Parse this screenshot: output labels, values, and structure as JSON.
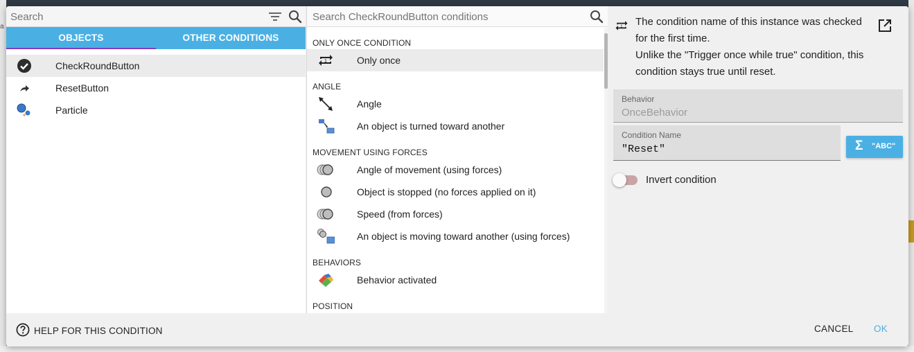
{
  "left_panel": {
    "search": {
      "placeholder": "Search",
      "value": ""
    },
    "tabs": [
      {
        "label": "OBJECTS",
        "active": true
      },
      {
        "label": "OTHER CONDITIONS",
        "active": false
      }
    ],
    "objects": [
      {
        "label": "CheckRoundButton",
        "icon": "checkmark-circle-icon",
        "selected": true
      },
      {
        "label": "ResetButton",
        "icon": "arrow-icon",
        "selected": false
      },
      {
        "label": "Particle",
        "icon": "particle-icon",
        "selected": false
      }
    ]
  },
  "middle_panel": {
    "search": {
      "placeholder": "Search CheckRoundButton conditions",
      "value": ""
    },
    "groups": [
      {
        "title": "ONLY ONCE CONDITION",
        "items": [
          {
            "label": "Only once",
            "icon": "repeat-once-icon",
            "selected": true
          }
        ]
      },
      {
        "title": "ANGLE",
        "items": [
          {
            "label": "Angle",
            "icon": "angle-arrow-icon"
          },
          {
            "label": "An object is turned toward another",
            "icon": "turn-toward-icon"
          }
        ]
      },
      {
        "title": "MOVEMENT USING FORCES",
        "items": [
          {
            "label": "Angle of movement (using forces)",
            "icon": "force-circles-icon"
          },
          {
            "label": "Object is stopped (no forces applied on it)",
            "icon": "stopped-circle-icon"
          },
          {
            "label": "Speed (from forces)",
            "icon": "force-circles-icon"
          },
          {
            "label": "An object is moving toward another (using forces)",
            "icon": "move-toward-icon"
          }
        ]
      },
      {
        "title": "BEHAVIORS",
        "items": [
          {
            "label": "Behavior activated",
            "icon": "behavior-icon"
          }
        ]
      },
      {
        "title": "POSITION",
        "items": []
      }
    ]
  },
  "right_panel": {
    "description": [
      "The condition name of this instance was checked for the first time.",
      "Unlike the \"Trigger once while true\" condition, this condition stays true until reset."
    ],
    "behavior_field": {
      "label": "Behavior",
      "value": "OnceBehavior"
    },
    "condition_name_field": {
      "label": "Condition Name",
      "value": "\"Reset\""
    },
    "expression_button": {
      "symbol": "Σ",
      "label": "\"ABC\""
    },
    "invert_condition": {
      "label": "Invert condition",
      "checked": false
    }
  },
  "footer": {
    "help_label": "HELP FOR THIS CONDITION",
    "cancel_label": "CANCEL",
    "ok_label": "OK"
  },
  "colors": {
    "accent": "#4ab0e4",
    "tab_indicator": "#7e3fbf",
    "selected_row": "#ebebeb",
    "panel_bg": "#f0f0f0"
  }
}
